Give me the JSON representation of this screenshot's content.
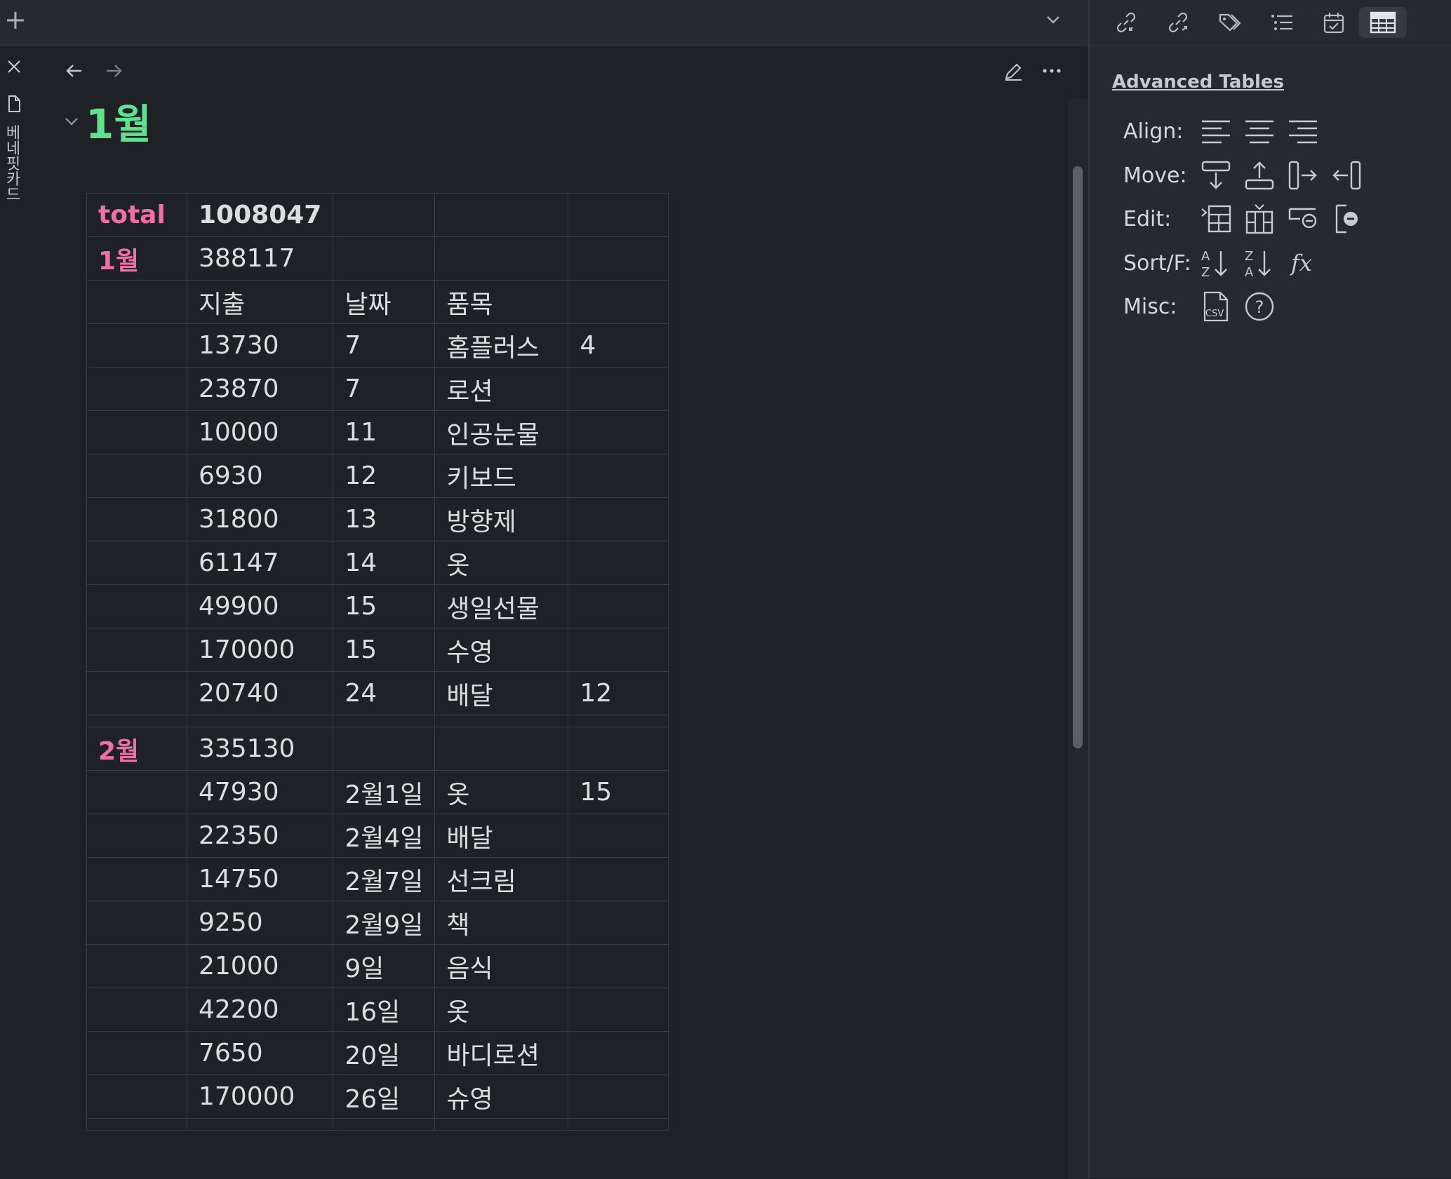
{
  "topbar": {
    "new_tab_glyph": "+",
    "icons": [
      "plus-icon",
      "chevron-down-icon"
    ]
  },
  "sidebar": {
    "vertical_tab_label": "베네핏카드",
    "icons": [
      "close-icon",
      "file-icon"
    ]
  },
  "editor": {
    "heading": "1월",
    "icons": [
      "arrow-left-icon",
      "arrow-right-icon",
      "pencil-icon",
      "more-horizontal-icon",
      "fold-chevron-icon"
    ]
  },
  "table": {
    "rows": [
      [
        "total",
        "1008047",
        "",
        "",
        ""
      ],
      [
        "1월",
        "388117",
        "",
        "",
        ""
      ],
      [
        "",
        "지출",
        "날짜",
        "품목",
        ""
      ],
      [
        "",
        "13730",
        "7",
        "홈플러스",
        "4"
      ],
      [
        "",
        "23870",
        "7",
        "로션",
        ""
      ],
      [
        "",
        "10000",
        "11",
        "인공눈물",
        ""
      ],
      [
        "",
        "6930",
        "12",
        "키보드",
        ""
      ],
      [
        "",
        "31800",
        "13",
        "방향제",
        ""
      ],
      [
        "",
        "61147",
        "14",
        "옷",
        ""
      ],
      [
        "",
        "49900",
        "15",
        "생일선물",
        ""
      ],
      [
        "",
        "170000",
        "15",
        "수영",
        ""
      ],
      [
        "",
        "20740",
        "24",
        "배달",
        "12"
      ],
      [
        "",
        "",
        "",
        "",
        ""
      ],
      [
        "2월",
        "335130",
        "",
        "",
        ""
      ],
      [
        "",
        "47930",
        "2월1일",
        "옷",
        "15"
      ],
      [
        "",
        "22350",
        "2월4일",
        "배달",
        ""
      ],
      [
        "",
        "14750",
        "2월7일",
        "선크림",
        ""
      ],
      [
        "",
        "9250",
        "2월9일",
        "책",
        ""
      ],
      [
        "",
        "21000",
        "9일",
        "음식",
        ""
      ],
      [
        "",
        "42200",
        "16일",
        "옷",
        ""
      ],
      [
        "",
        "7650",
        "20일",
        "바디로션",
        ""
      ],
      [
        "",
        "170000",
        "26일",
        "슈영",
        ""
      ],
      [
        "",
        "",
        "",
        "",
        ""
      ]
    ]
  },
  "right_panel": {
    "title": "Advanced Tables",
    "toolbar_icons": [
      "backlinks-icon",
      "outgoing-links-icon",
      "tags-icon",
      "outline-icon",
      "calendar-icon",
      "table-icon"
    ],
    "rows": [
      {
        "label": "Align:",
        "icons": [
          "align-left-icon",
          "align-center-icon",
          "align-right-icon"
        ]
      },
      {
        "label": "Move:",
        "icons": [
          "move-row-down-icon",
          "move-row-up-icon",
          "move-column-right-icon",
          "move-column-left-icon"
        ]
      },
      {
        "label": "Edit:",
        "icons": [
          "insert-row-icon",
          "insert-column-icon",
          "delete-row-icon",
          "delete-column-icon"
        ]
      },
      {
        "label": "Sort/F:",
        "icons": [
          "sort-asc-icon",
          "sort-desc-icon",
          "formula-icon"
        ]
      },
      {
        "label": "Misc:",
        "icons": [
          "export-csv-icon",
          "help-icon"
        ]
      }
    ],
    "glyphs": {
      "sort_asc_top": "A",
      "sort_asc_bottom": "Z",
      "sort_desc_top": "Z",
      "sort_desc_bottom": "A",
      "formula": "fx",
      "csv": "CSV",
      "help": "?"
    }
  },
  "colors": {
    "background": "#1e2126",
    "panel": "#262930",
    "heading_green": "#5fe18d",
    "label_pink": "#ef6fa6",
    "text": "#dcddde"
  }
}
